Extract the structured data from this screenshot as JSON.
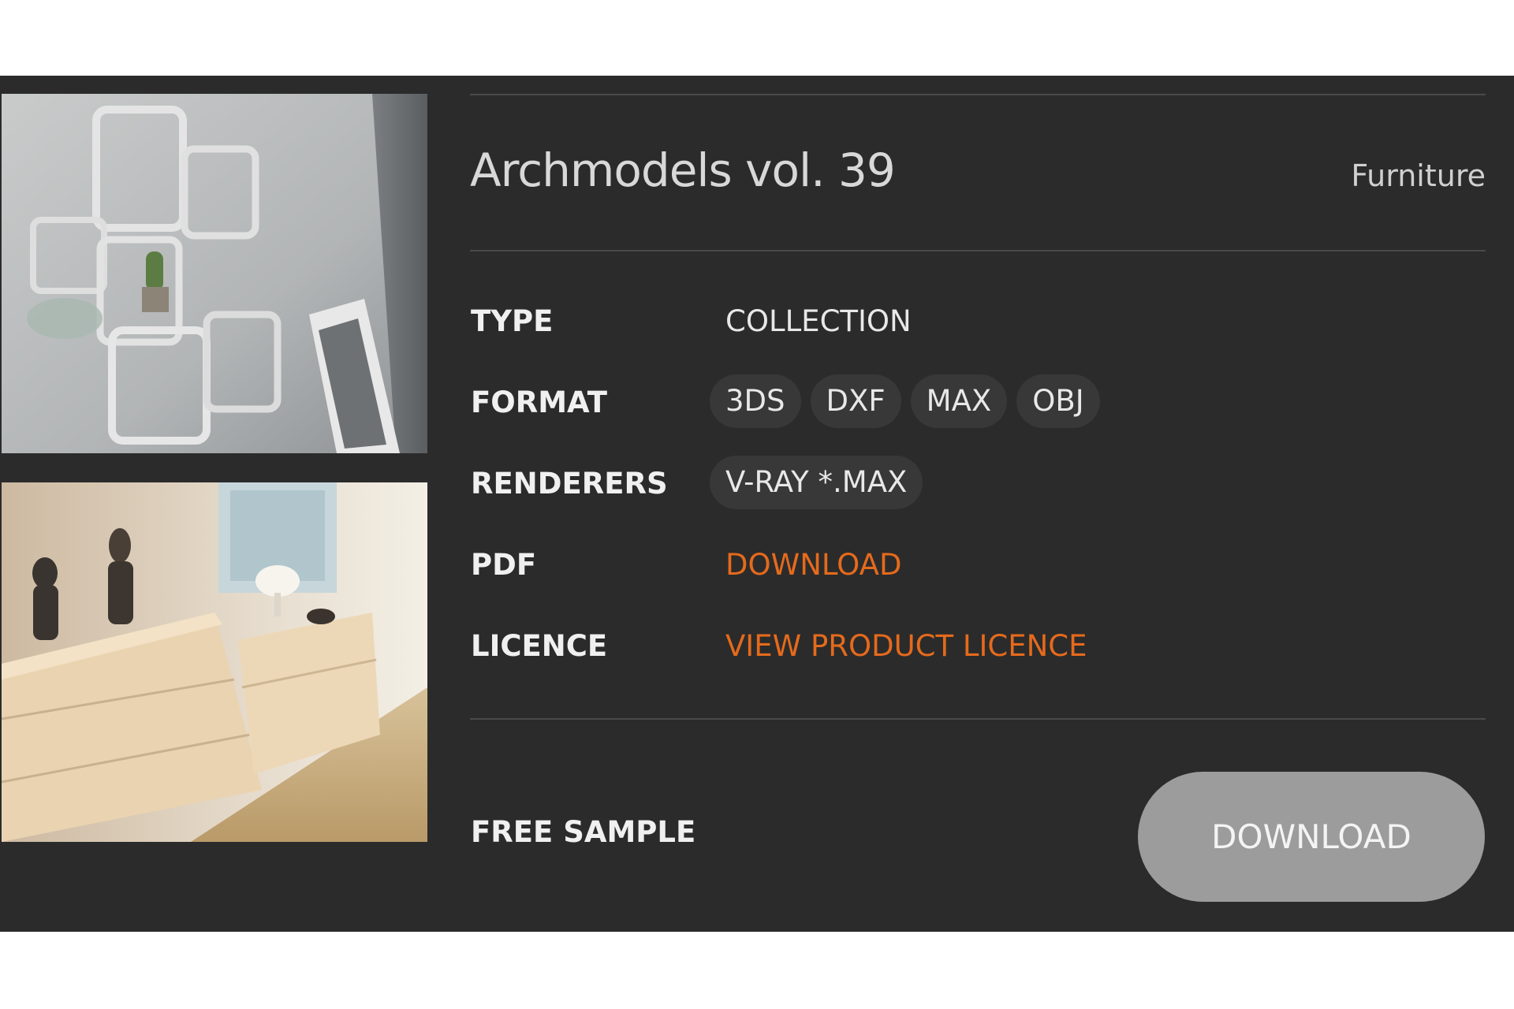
{
  "product": {
    "title": "Archmodels vol. 39",
    "category": "Furniture"
  },
  "images": [
    {
      "alt": "wall-shelves-render"
    },
    {
      "alt": "bedroom-dresser-render"
    }
  ],
  "details": {
    "type": {
      "label": "TYPE",
      "value": "COLLECTION"
    },
    "format": {
      "label": "FORMAT",
      "values": [
        "3DS",
        "DXF",
        "MAX",
        "OBJ"
      ]
    },
    "renderers": {
      "label": "RENDERERS",
      "values": [
        "V-RAY *.MAX"
      ]
    },
    "pdf": {
      "label": "PDF",
      "link": "DOWNLOAD"
    },
    "licence": {
      "label": "LICENCE",
      "link": "VIEW PRODUCT LICENCE"
    }
  },
  "sample": {
    "label": "FREE SAMPLE",
    "button": "DOWNLOAD"
  },
  "colors": {
    "panel_bg": "#2b2b2b",
    "accent_link": "#e56a1c",
    "pill_bg": "#383838",
    "button_bg": "#9c9c9c"
  }
}
